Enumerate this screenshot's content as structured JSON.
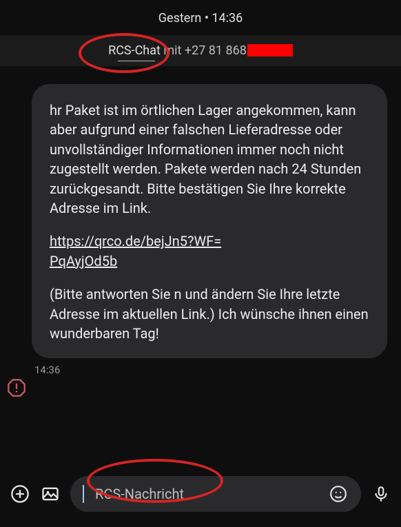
{
  "header": {
    "date_line": "Gestern • 14:36"
  },
  "chat_info": {
    "rcs_label": "RCS-Chat",
    "with_text": " mit ",
    "phone_prefix": "+27 81 868"
  },
  "message": {
    "body_1": "hr Paket ist im örtlichen Lager angekommen, kann aber aufgrund einer falschen Lieferadresse oder unvollständiger Informationen immer noch nicht zugestellt werden. Pakete werden nach 24 Stunden zurückgesandt. Bitte bestätigen Sie Ihre korrekte Adresse im Link.",
    "link_line1": "https://qrco.de/bejJn5?WF=",
    "link_line2": "PqAyjOd5b",
    "body_2": "(Bitte antworten Sie n und ändern Sie Ihre letzte Adresse im aktuellen Link.) Ich wünsche ihnen einen wunderbaren Tag!",
    "timestamp": "14:36"
  },
  "composer": {
    "placeholder": "RCS-Nachricht"
  },
  "icons": {
    "plus": "plus-icon",
    "gallery": "gallery-icon",
    "emoji": "emoji-icon",
    "mic": "mic-icon",
    "spam": "spam-warning-icon"
  }
}
